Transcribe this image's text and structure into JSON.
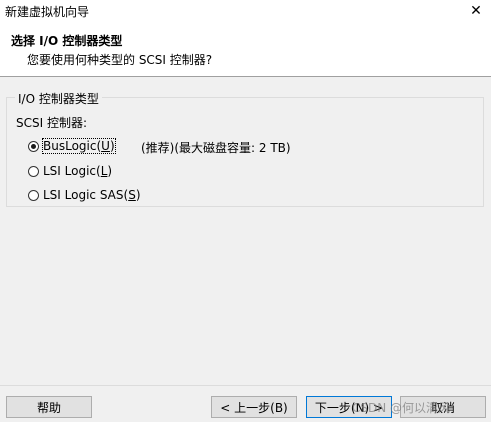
{
  "window": {
    "title": "新建虚拟机向导",
    "close_glyph": "✕"
  },
  "header": {
    "title": "选择 I/O 控制器类型",
    "subtitle": "您要使用何种类型的 SCSI 控制器?"
  },
  "group": {
    "legend": "I/O 控制器类型",
    "label": "SCSI 控制器:",
    "options": [
      {
        "text": "BusLogic(",
        "key": "U",
        "suffix": ")",
        "checked": true
      },
      {
        "text": "LSI Logic(",
        "key": "L",
        "suffix": ")",
        "checked": false
      },
      {
        "text": "LSI Logic SAS(",
        "key": "S",
        "suffix": ")",
        "checked": false
      }
    ],
    "recommend_note": "(推荐)(最大磁盘容量: 2 TB)"
  },
  "buttons": {
    "help": "帮助",
    "back": "< 上一步(B)",
    "next": "下一步(N) >",
    "cancel": "取消"
  },
  "watermark": "CSDN @何以清风"
}
